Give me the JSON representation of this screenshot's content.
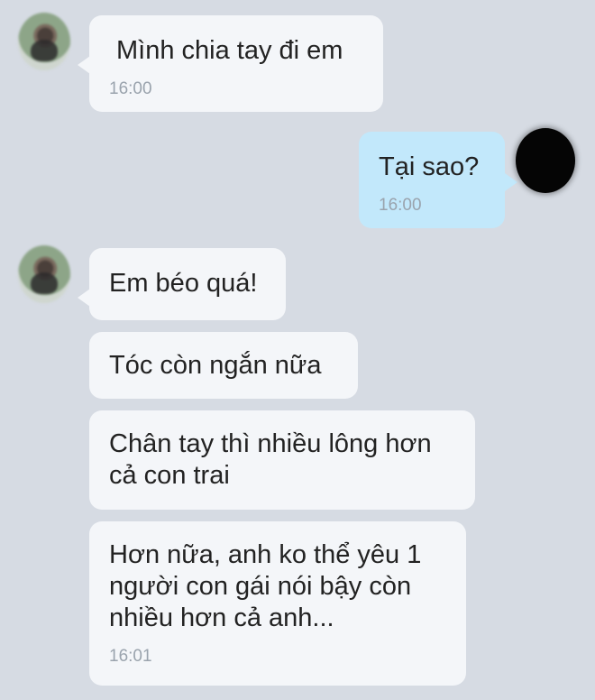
{
  "messages": [
    {
      "sender": "them",
      "text": "Mình chia tay đi em",
      "time": "16:00"
    },
    {
      "sender": "me",
      "text": "Tại sao?",
      "time": "16:00"
    },
    {
      "sender": "them",
      "text": "Em béo quá!"
    },
    {
      "sender": "them",
      "text": "Tóc còn ngắn nữa"
    },
    {
      "sender": "them",
      "text": "Chân tay thì nhiều lông hơn cả con trai"
    },
    {
      "sender": "them",
      "text": "Hơn nữa, anh ko thể yêu 1 người con gái nói bậy còn nhiều hơn cả anh...",
      "time": "16:01"
    }
  ],
  "colors": {
    "background": "#d6dbe3",
    "incoming_bubble": "#f4f6f9",
    "outgoing_bubble": "#c2e8fb",
    "timestamp": "#9aa3ad"
  }
}
